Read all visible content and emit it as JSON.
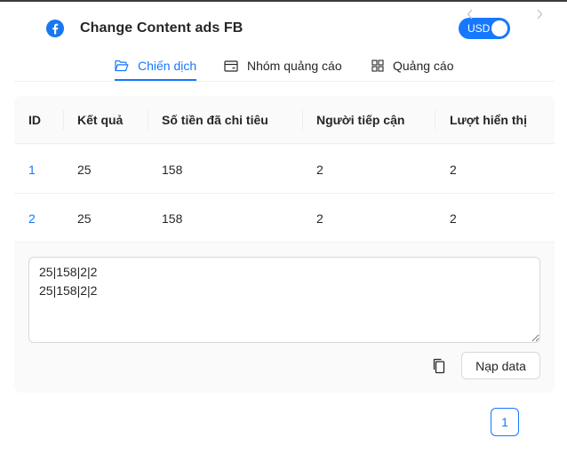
{
  "header": {
    "title": "Change Content ads FB",
    "brand_icon": "facebook-icon",
    "currency_toggle": {
      "label": "USD",
      "on": true
    }
  },
  "tabs": [
    {
      "label": "Chiến dịch",
      "icon": "folder-open-icon",
      "active": true
    },
    {
      "label": "Nhóm quảng cáo",
      "icon": "credit-card-icon",
      "active": false
    },
    {
      "label": "Quảng cáo",
      "icon": "grid-icon",
      "active": false
    }
  ],
  "table": {
    "columns": [
      "ID",
      "Kết quả",
      "Số tiền đã chi tiêu",
      "Người tiếp cận",
      "Lượt hiển thị"
    ],
    "rows": [
      [
        "1",
        "25",
        "158",
        "2",
        "2"
      ],
      [
        "2",
        "25",
        "158",
        "2",
        "2"
      ]
    ]
  },
  "textarea": {
    "value": "25|158|2|2\n25|158|2|2"
  },
  "actions": {
    "copy_icon": "copy-icon",
    "load_label": "Nạp data"
  },
  "pagination": {
    "current": "1"
  },
  "colors": {
    "accent": "#1677ff",
    "card_bg": "#fafafa"
  }
}
